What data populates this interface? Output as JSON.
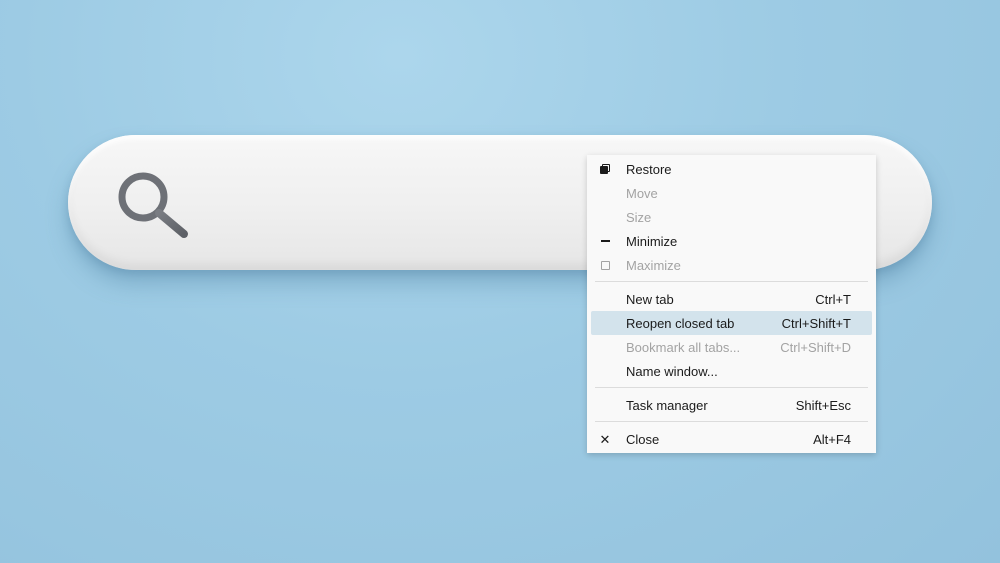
{
  "search_bar": {
    "icon": "search-icon"
  },
  "context_menu": {
    "items": [
      {
        "label": "Restore",
        "shortcut": "",
        "icon": "restore-icon",
        "enabled": true
      },
      {
        "label": "Move",
        "shortcut": "",
        "icon": "",
        "enabled": false
      },
      {
        "label": "Size",
        "shortcut": "",
        "icon": "",
        "enabled": false
      },
      {
        "label": "Minimize",
        "shortcut": "",
        "icon": "minimize-icon",
        "enabled": true
      },
      {
        "label": "Maximize",
        "shortcut": "",
        "icon": "maximize-icon",
        "enabled": false
      },
      {
        "label": "New tab",
        "shortcut": "Ctrl+T",
        "icon": "",
        "enabled": true
      },
      {
        "label": "Reopen closed tab",
        "shortcut": "Ctrl+Shift+T",
        "icon": "",
        "enabled": true,
        "highlighted": true
      },
      {
        "label": "Bookmark all tabs...",
        "shortcut": "Ctrl+Shift+D",
        "icon": "",
        "enabled": false
      },
      {
        "label": "Name window...",
        "shortcut": "",
        "icon": "",
        "enabled": true
      },
      {
        "label": "Task manager",
        "shortcut": "Shift+Esc",
        "icon": "",
        "enabled": true
      },
      {
        "label": "Close",
        "shortcut": "Alt+F4",
        "icon": "close-icon",
        "enabled": true
      }
    ]
  },
  "colors": {
    "background": "#9dcbe4",
    "menu_background": "#f9f9f9",
    "highlight": "#d3e3ec",
    "disabled_text": "#a3a3a3",
    "icon_stroke": "#6e7177"
  }
}
